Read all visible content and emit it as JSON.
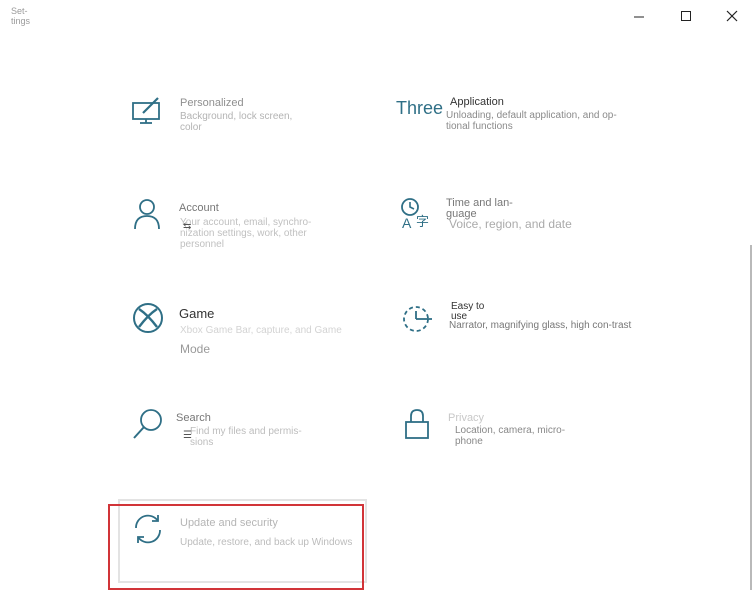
{
  "window": {
    "title": "Set-\ntings"
  },
  "accent": "#2f6f86",
  "highlight_color": "#d13438",
  "tiles": [
    {
      "name": "Personalized",
      "desc": "Background, lock screen, color",
      "icon": "paint-monitor-icon"
    },
    {
      "number": "Three",
      "name": "Application",
      "desc": "Unloading, default application, and op-tional functions",
      "icon": "apps-icon"
    },
    {
      "name": "Account",
      "desc": "Your account, email, synchro-nization settings, work, other personnel",
      "icon": "person-icon"
    },
    {
      "name": "Time and lan-guage",
      "desc": "Voice, region, and date",
      "icon": "time-language-icon"
    },
    {
      "name": "Game",
      "desc": "Xbox Game Bar, capture, and Game",
      "desc2": "Mode",
      "icon": "xbox-icon"
    },
    {
      "name": "Easy to use",
      "desc": "Narrator, magnifying glass, high con-trast",
      "icon": "ease-of-access-icon"
    },
    {
      "name": "Search",
      "desc": "Find my files and permis-sions",
      "icon": "search-icon"
    },
    {
      "name": "Privacy",
      "desc": "Location, camera, micro-phone",
      "icon": "lock-icon"
    },
    {
      "name": "Update and security",
      "desc": "Update, restore, and back up Windows",
      "icon": "sync-icon"
    }
  ]
}
